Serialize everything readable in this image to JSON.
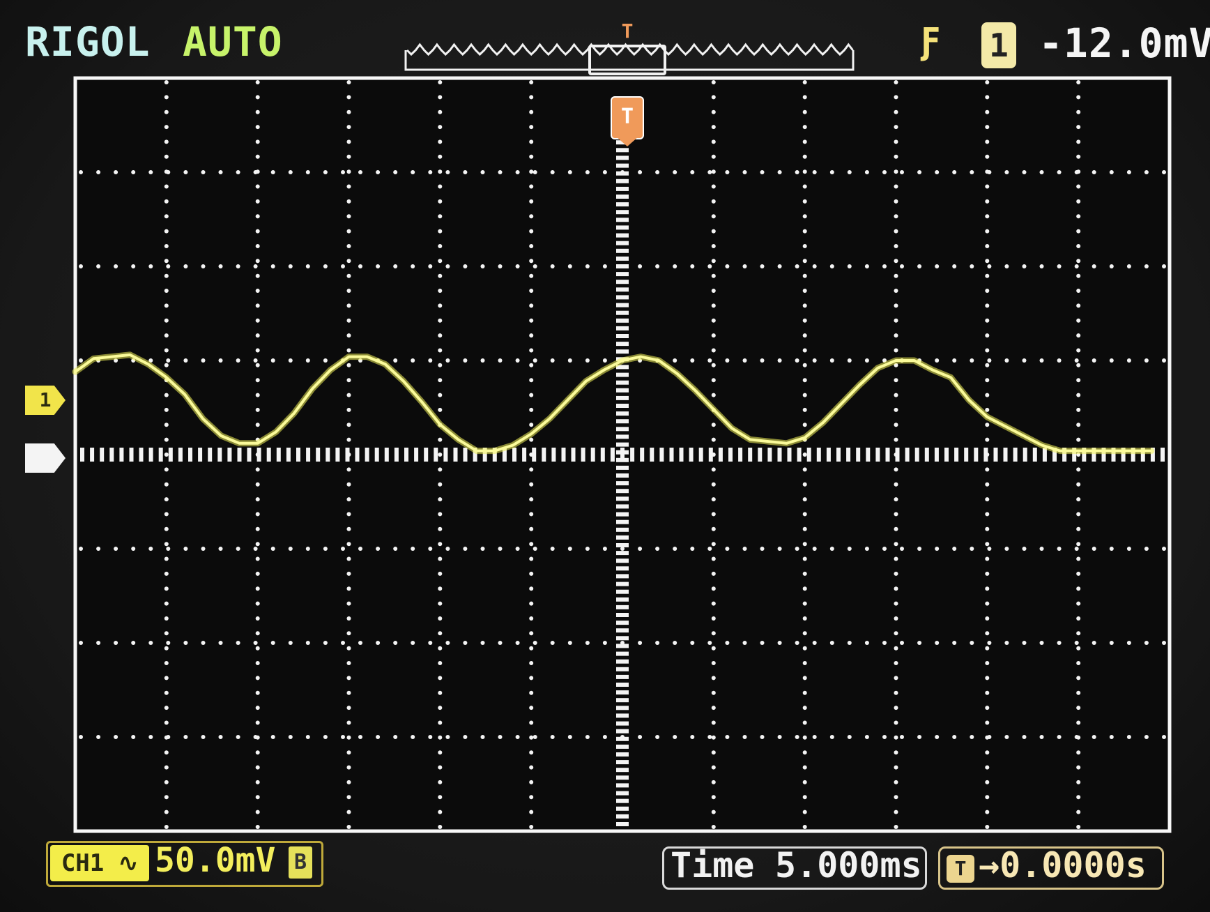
{
  "header": {
    "brand": "RIGOL",
    "mode": "AUTO",
    "trigger_marker": "T",
    "trigger_edge": "Ƒ",
    "trigger_source": "1",
    "trigger_level": "-12.0mV"
  },
  "markers": {
    "channel1": "1",
    "ground": "",
    "trigger": "T"
  },
  "footer": {
    "channel_badge": "CH1 ∿",
    "channel_scale": "50.0mV",
    "bandwidth_icon": "B",
    "time_label": "Time",
    "time_value": "5.000ms",
    "offset_icon": "T",
    "offset_value": "→0.0000s"
  },
  "colors": {
    "trace": "#f2f25a",
    "grid": "#f4f4f4",
    "trigger": "#f09a5a",
    "brand": "#c8f1ee",
    "mode": "#c7f36a"
  },
  "chart_data": {
    "type": "line",
    "x_units": "ms",
    "y_units": "mV",
    "time_per_div_ms": 5.0,
    "volts_per_div_mv": 50.0,
    "x_divisions": 12,
    "y_divisions": 8,
    "x_range_ms": [
      -30,
      30
    ],
    "y_range_mv": [
      -140,
      260
    ],
    "grid": true,
    "series": [
      {
        "x": [
          -30,
          -29,
          -28,
          -27,
          -26,
          -25,
          -24,
          -23,
          -22,
          -21,
          -20,
          -19,
          -18,
          -17,
          -16,
          -15,
          -14,
          -13,
          -12,
          -11,
          -10,
          -9,
          -8,
          -7,
          -6,
          -5,
          -4,
          -3,
          -2,
          -1,
          0,
          1,
          2,
          3,
          4,
          5,
          6,
          7,
          8,
          9,
          10,
          11,
          12,
          13,
          14,
          15,
          16,
          17,
          18,
          19,
          20,
          21,
          22,
          23,
          24,
          25,
          26,
          27,
          28,
          29
        ],
        "y": [
          104,
          111,
          112,
          113,
          108,
          101,
          92,
          79,
          70,
          66,
          66,
          72,
          82,
          95,
          105,
          112,
          112,
          108,
          99,
          88,
          76,
          68,
          62,
          62,
          65,
          71,
          79,
          89,
          99,
          105,
          110,
          112,
          110,
          103,
          94,
          84,
          74,
          68,
          67,
          66,
          69,
          77,
          87,
          97,
          106,
          110,
          110,
          105,
          101,
          89,
          80,
          75,
          70,
          65,
          62,
          62,
          62,
          62,
          62,
          62
        ]
      }
    ]
  }
}
